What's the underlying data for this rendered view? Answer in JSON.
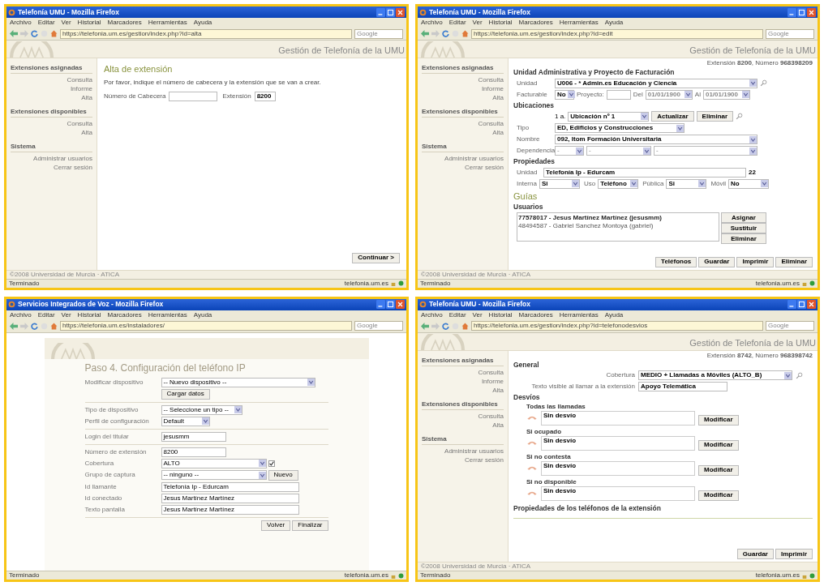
{
  "windows": [
    {
      "title": "Telefonía UMU - Mozilla Firefox",
      "menu": [
        "Archivo",
        "Editar",
        "Ver",
        "Historial",
        "Marcadores",
        "Herramientas",
        "Ayuda"
      ],
      "url": "https://telefonia.um.es/gestion/index.php?id=alta",
      "search_placeholder": "Google",
      "status": "Terminado",
      "status_host": "telefonia.um.es",
      "page": {
        "kind": "alta",
        "header": "Gestión de Telefonía de la UMU",
        "footer": "©2008 Universidad de Murcia · ATICA",
        "sidebar": [
          {
            "heading": "Extensiones asignadas",
            "items": [
              "Consulta",
              "Informe",
              "Alta"
            ]
          },
          {
            "heading": "Extensiones disponibles",
            "items": [
              "Consulta",
              "Alta"
            ]
          },
          {
            "heading": "Sistema",
            "items": [
              "Administrar usuarios",
              "Cerrar sesión"
            ]
          }
        ],
        "title": "Alta de extensión",
        "intro": "Por favor, indique el número de cabecera y la extensión que se van a crear.",
        "fields": [
          {
            "label": "Número de Cabecera"
          },
          {
            "label": "Extensión",
            "value": "8200"
          }
        ],
        "button": "Continuar >"
      }
    },
    {
      "title": "Telefonía UMU - Mozilla Firefox",
      "menu": [
        "Archivo",
        "Editar",
        "Ver",
        "Historial",
        "Marcadores",
        "Herramientas",
        "Ayuda"
      ],
      "url": "https://telefonia.um.es/gestion/index.php?id=edit",
      "search_placeholder": "Google",
      "status": "Terminado",
      "status_host": "telefonia.um.es",
      "page": {
        "kind": "edit",
        "header": "Gestión de Telefonía de la UMU",
        "footer": "©2008 Universidad de Murcia · ATICA",
        "sidebar": [
          {
            "heading": "Extensiones asignadas",
            "items": [
              "Consulta",
              "Informe",
              "Alta"
            ]
          },
          {
            "heading": "Extensiones disponibles",
            "items": [
              "Consulta",
              "Alta"
            ]
          },
          {
            "heading": "Sistema",
            "items": [
              "Administrar usuarios",
              "Cerrar sesión"
            ]
          }
        ],
        "ext_info": "Extensión **8200**, Número **968398209**",
        "billing": {
          "heading": "Unidad Administrativa y Proyecto de Facturación",
          "unit_label": "Unidad",
          "unit": "U006 - * Admin.es Educación y Ciencia",
          "billable_label": "Facturable",
          "billable": "No",
          "project_label": "Proyecto:",
          "from_label": "Del",
          "from": "01/01/1900",
          "to_label": "Al",
          "to": "01/01/1900"
        },
        "locations": {
          "heading": "Ubicaciones",
          "index": "1 a.",
          "location": "Ubicación nº 1",
          "buttons": [
            "Actualizar",
            "Eliminar"
          ],
          "rows": [
            {
              "label": "Tipo",
              "value": "ED, Edificios y Construcciones"
            },
            {
              "label": "Nombre",
              "value": "092, Itom Formación Universitaria"
            }
          ],
          "dependency_label": "Dependencia",
          "dependency": [
            "-",
            "-",
            "-"
          ]
        },
        "properties": {
          "heading": "Propiedades",
          "unit_label": "Unidad",
          "unit": "Telefonía Ip - Edurcam",
          "count": "22",
          "fields": [
            {
              "label": "Interna",
              "value": "Si"
            },
            {
              "label": "Uso",
              "value": "Teléfono"
            },
            {
              "label": "Pública",
              "value": "Si"
            },
            {
              "label": "Móvil",
              "value": "No"
            }
          ]
        },
        "guides": "Guías",
        "users_heading": "Usuarios",
        "users": [
          {
            "text": "77578017 - Jesus Martínez Martínez (jesusmm)",
            "selected": true
          },
          {
            "text": "48494587 - Gabriel Sanchez Montoya (gabriel)",
            "selected": false
          }
        ],
        "user_buttons": [
          "Asignar",
          "Sustituir",
          "Eliminar"
        ],
        "buttons": [
          "Teléfonos",
          "Guardar",
          "Imprimir",
          "Eliminar"
        ]
      }
    },
    {
      "title": "Servicios Integrados de Voz - Mozilla Firefox",
      "menu": [
        "Archivo",
        "Editar",
        "Ver",
        "Historial",
        "Marcadores",
        "Herramientas",
        "Ayuda"
      ],
      "url": "https://telefonia.um.es/instaladores/",
      "search_placeholder": "Google",
      "status": "Terminado",
      "status_host": "telefonia.um.es",
      "page": {
        "kind": "installer",
        "title": "Paso 4. Configuración del teléfono IP",
        "sections": [
          [
            {
              "kind": "select",
              "label": "Modificar dispositivo",
              "value": "-- Nuevo dispositivo --",
              "button": "Cargar datos"
            }
          ],
          [
            {
              "kind": "select",
              "label": "Tipo de dispositivo",
              "value": "-- Seleccione un tipo --"
            },
            {
              "kind": "select",
              "label": "Perfil de configuración",
              "value": "Default"
            }
          ],
          [
            {
              "kind": "input",
              "label": "Login del titular",
              "value": "jesusmm"
            }
          ],
          [
            {
              "kind": "input",
              "label": "Número de extensión",
              "value": "8200"
            },
            {
              "kind": "select",
              "label": "Cobertura",
              "value": "ALTO",
              "checked": true
            },
            {
              "kind": "select",
              "label": "Grupo de captura",
              "value": "-- ninguno --",
              "button": "Nuevo"
            },
            {
              "kind": "input",
              "label": "Id llamante",
              "value": "Telefonía Ip - Edurcam"
            },
            {
              "kind": "input",
              "label": "Id conectado",
              "value": "Jesus Martínez Martínez"
            },
            {
              "kind": "input",
              "label": "Texto pantalla",
              "value": "Jesus Martínez Martínez"
            }
          ]
        ],
        "buttons": [
          "Volver",
          "Finalizar"
        ]
      }
    },
    {
      "title": "Telefonía UMU - Mozilla Firefox",
      "menu": [
        "Archivo",
        "Editar",
        "Ver",
        "Historial",
        "Marcadores",
        "Herramientas",
        "Ayuda"
      ],
      "url": "https://telefonia.um.es/gestion/index.php?id=telefonodesvios",
      "search_placeholder": "Google",
      "status": "Terminado",
      "status_host": "telefonia.um.es",
      "page": {
        "kind": "desvios",
        "header": "Gestión de Telefonía de la UMU",
        "footer": "©2008 Universidad de Murcia · ATICA",
        "sidebar": [
          {
            "heading": "Extensiones asignadas",
            "items": [
              "Consulta",
              "Informe",
              "Alta"
            ]
          },
          {
            "heading": "Extensiones disponibles",
            "items": [
              "Consulta",
              "Alta"
            ]
          },
          {
            "heading": "Sistema",
            "items": [
              "Administrar usuarios",
              "Cerrar sesión"
            ]
          }
        ],
        "ext_info": "Extensión **8742**, Número **968398742**",
        "general_heading": "General",
        "general": [
          {
            "kind": "select",
            "label": "Cobertura",
            "value": "MEDIO + Llamadas a Móviles (ALTO_B)"
          },
          {
            "kind": "input",
            "label": "Texto visible al llamar a la extensión",
            "value": "Apoyo Telemática"
          }
        ],
        "diversions_heading": "Desvíos",
        "diversions": [
          {
            "label": "Todas las llamadas",
            "value": "Sin desvío",
            "button": "Modificar"
          },
          {
            "label": "Si ocupado",
            "value": "Sin desvío",
            "button": "Modificar"
          },
          {
            "label": "Si no contesta",
            "value": "Sin desvío",
            "button": "Modificar"
          },
          {
            "label": "Si no disponible",
            "value": "Sin desvío",
            "button": "Modificar"
          }
        ],
        "phones_heading": "Propiedades de los teléfonos de la extensión",
        "buttons": [
          "Guardar",
          "Imprimir"
        ]
      }
    }
  ]
}
